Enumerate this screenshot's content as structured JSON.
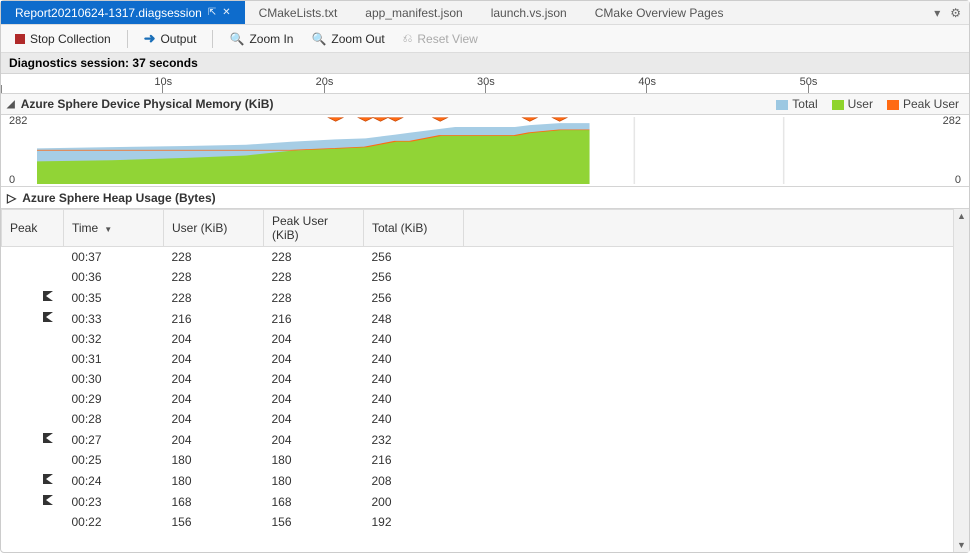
{
  "tabs": [
    {
      "label": "Report20210624-1317.diagsession",
      "active": true
    },
    {
      "label": "CMakeLists.txt",
      "active": false
    },
    {
      "label": "app_manifest.json",
      "active": false
    },
    {
      "label": "launch.vs.json",
      "active": false
    },
    {
      "label": "CMake Overview Pages",
      "active": false
    }
  ],
  "toolbar": {
    "stop": "Stop Collection",
    "output": "Output",
    "zoom_in": "Zoom In",
    "zoom_out": "Zoom Out",
    "reset": "Reset View"
  },
  "session": {
    "label": "Diagnostics session:",
    "value": "37 seconds"
  },
  "ruler": {
    "ticks": [
      "10s",
      "20s",
      "30s",
      "40s",
      "50s"
    ]
  },
  "chart": {
    "title": "Azure Sphere Device Physical Memory (KiB)",
    "legend": {
      "total": "Total",
      "user": "User",
      "peak_user": "Peak User"
    },
    "ymax": "282",
    "ymin": "0"
  },
  "collapsed": {
    "title": "Azure Sphere Heap Usage (Bytes)"
  },
  "table": {
    "headers": {
      "peak": "Peak",
      "time": "Time",
      "user": "User (KiB)",
      "peak_user": "Peak User (KiB)",
      "total": "Total (KiB)"
    },
    "rows": [
      {
        "flag": false,
        "time": "00:37",
        "user": "228",
        "peak_user": "228",
        "total": "256"
      },
      {
        "flag": false,
        "time": "00:36",
        "user": "228",
        "peak_user": "228",
        "total": "256"
      },
      {
        "flag": true,
        "time": "00:35",
        "user": "228",
        "peak_user": "228",
        "total": "256"
      },
      {
        "flag": true,
        "time": "00:33",
        "user": "216",
        "peak_user": "216",
        "total": "248"
      },
      {
        "flag": false,
        "time": "00:32",
        "user": "204",
        "peak_user": "204",
        "total": "240"
      },
      {
        "flag": false,
        "time": "00:31",
        "user": "204",
        "peak_user": "204",
        "total": "240"
      },
      {
        "flag": false,
        "time": "00:30",
        "user": "204",
        "peak_user": "204",
        "total": "240"
      },
      {
        "flag": false,
        "time": "00:29",
        "user": "204",
        "peak_user": "204",
        "total": "240"
      },
      {
        "flag": false,
        "time": "00:28",
        "user": "204",
        "peak_user": "204",
        "total": "240"
      },
      {
        "flag": true,
        "time": "00:27",
        "user": "204",
        "peak_user": "204",
        "total": "232"
      },
      {
        "flag": false,
        "time": "00:25",
        "user": "180",
        "peak_user": "180",
        "total": "216"
      },
      {
        "flag": true,
        "time": "00:24",
        "user": "180",
        "peak_user": "180",
        "total": "208"
      },
      {
        "flag": true,
        "time": "00:23",
        "user": "168",
        "peak_user": "168",
        "total": "200"
      },
      {
        "flag": false,
        "time": "00:22",
        "user": "156",
        "peak_user": "156",
        "total": "192"
      }
    ]
  },
  "colors": {
    "total": "#9cc8e2",
    "user": "#8fd42c",
    "peak_user": "#ff6a13"
  },
  "chart_data": {
    "type": "area",
    "title": "Azure Sphere Device Physical Memory (KiB)",
    "xlabel": "",
    "ylabel": "KiB",
    "ylim": [
      0,
      282
    ],
    "x_seconds": [
      0,
      5,
      10,
      14,
      17,
      20,
      22,
      23,
      24,
      25,
      27,
      28,
      29,
      30,
      31,
      32,
      33,
      35,
      36,
      37
    ],
    "notes": "x axis is elapsed time in seconds; the timeline extent covers ~60s but data exists only up to 37s",
    "series": [
      {
        "name": "Total",
        "values": [
          150,
          155,
          160,
          165,
          178,
          188,
          192,
          200,
          208,
          216,
          232,
          240,
          240,
          240,
          240,
          240,
          248,
          256,
          256,
          256
        ]
      },
      {
        "name": "User",
        "values": [
          95,
          100,
          110,
          120,
          140,
          150,
          156,
          168,
          180,
          180,
          204,
          204,
          204,
          204,
          204,
          204,
          216,
          228,
          228,
          228
        ]
      },
      {
        "name": "Peak User",
        "values": [
          142,
          142,
          142,
          142,
          142,
          150,
          156,
          168,
          180,
          180,
          204,
          204,
          204,
          204,
          204,
          204,
          216,
          228,
          228,
          228
        ]
      }
    ],
    "markers_seconds": [
      20,
      22,
      23,
      24,
      27,
      33,
      35
    ]
  }
}
